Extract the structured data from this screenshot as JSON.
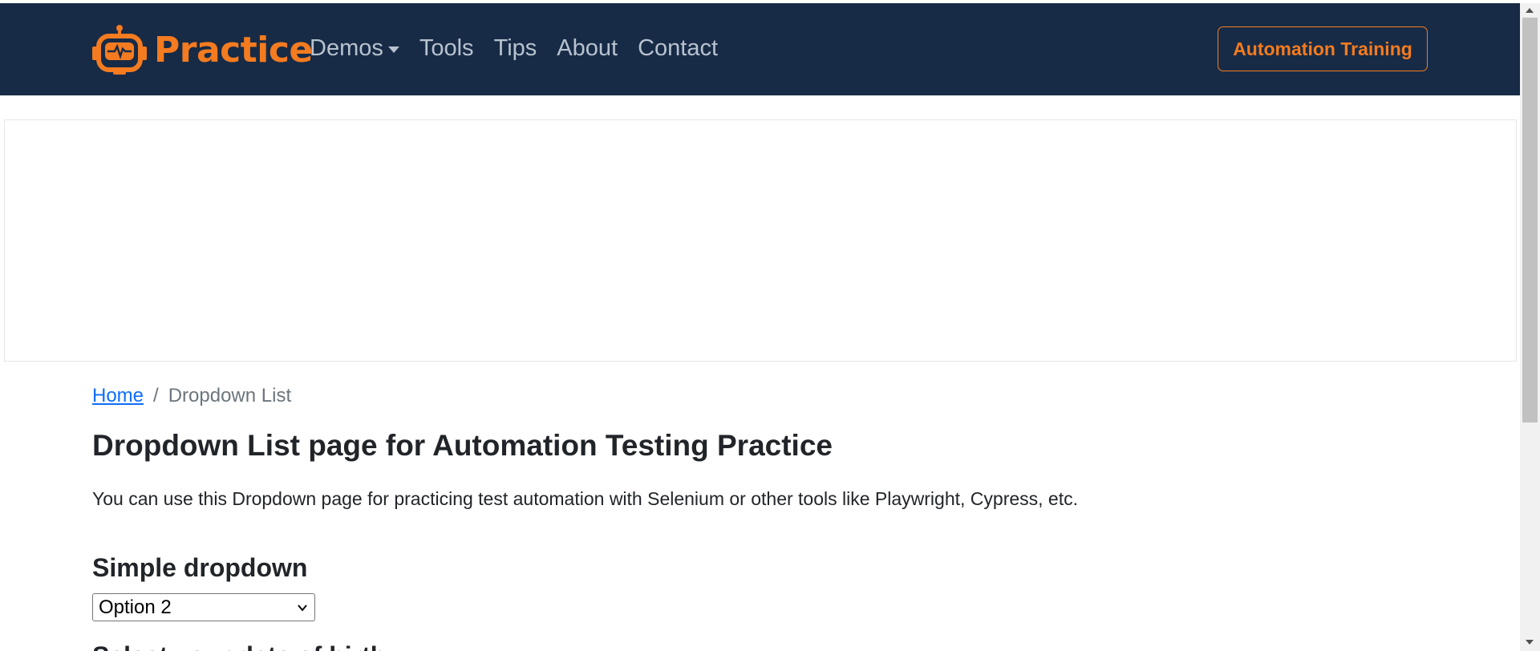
{
  "brand": {
    "name": "Practice",
    "icon": "robot-logo-icon",
    "color": "#f47b20"
  },
  "nav": {
    "items": [
      {
        "label": "Demos",
        "has_dropdown": true
      },
      {
        "label": "Tools"
      },
      {
        "label": "Tips"
      },
      {
        "label": "About"
      },
      {
        "label": "Contact"
      }
    ],
    "cta_label": "Automation Training",
    "background": "#172b46"
  },
  "breadcrumb": {
    "home": "Home",
    "separator": "/",
    "current": "Dropdown List"
  },
  "page": {
    "title": "Dropdown List page for Automation Testing Practice",
    "intro": "You can use this Dropdown page for practicing test automation with Selenium or other tools like Playwright, Cypress, etc."
  },
  "simple_dropdown": {
    "heading": "Simple dropdown",
    "selected": "Option 2"
  },
  "next_section": {
    "heading": "Select your date of birth"
  }
}
